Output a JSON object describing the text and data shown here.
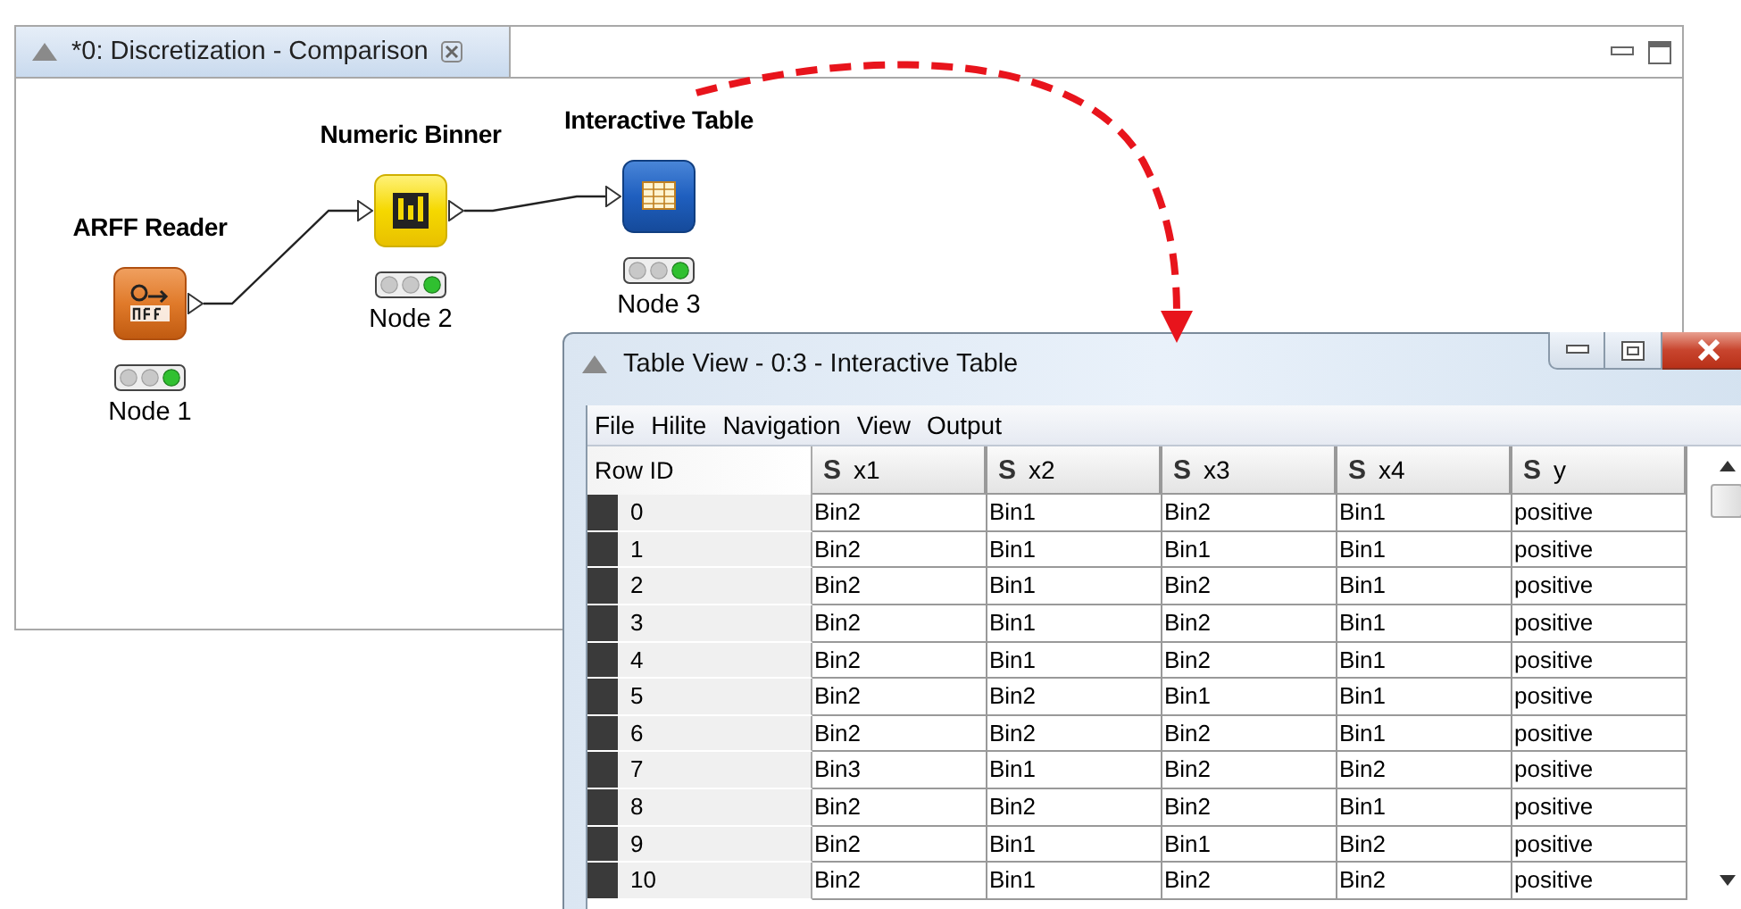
{
  "editor": {
    "tab_title": "*0: Discretization - Comparison",
    "nodes": [
      {
        "title": "ARFF Reader",
        "kind": "reader",
        "executed": true,
        "label": "Node 1"
      },
      {
        "title": "Numeric Binner",
        "kind": "binner",
        "executed": true,
        "label": "Node 2"
      },
      {
        "title": "Interactive Table",
        "kind": "table",
        "executed": true,
        "label": "Node 3"
      }
    ]
  },
  "table_view": {
    "title": "Table View - 0:3 - Interactive Table",
    "menu": [
      "File",
      "Hilite",
      "Navigation",
      "View",
      "Output"
    ],
    "row_id_header": "Row ID",
    "columns": [
      {
        "type_icon": "S",
        "label": "x1"
      },
      {
        "type_icon": "S",
        "label": "x2"
      },
      {
        "type_icon": "S",
        "label": "x3"
      },
      {
        "type_icon": "S",
        "label": "x4"
      },
      {
        "type_icon": "S",
        "label": "y"
      }
    ],
    "rows": [
      {
        "id": "0",
        "cells": [
          "Bin2",
          "Bin1",
          "Bin2",
          "Bin1",
          "positive"
        ]
      },
      {
        "id": "1",
        "cells": [
          "Bin2",
          "Bin1",
          "Bin1",
          "Bin1",
          "positive"
        ]
      },
      {
        "id": "2",
        "cells": [
          "Bin2",
          "Bin1",
          "Bin2",
          "Bin1",
          "positive"
        ]
      },
      {
        "id": "3",
        "cells": [
          "Bin2",
          "Bin1",
          "Bin2",
          "Bin1",
          "positive"
        ]
      },
      {
        "id": "4",
        "cells": [
          "Bin2",
          "Bin1",
          "Bin2",
          "Bin1",
          "positive"
        ]
      },
      {
        "id": "5",
        "cells": [
          "Bin2",
          "Bin2",
          "Bin1",
          "Bin1",
          "positive"
        ]
      },
      {
        "id": "6",
        "cells": [
          "Bin2",
          "Bin2",
          "Bin2",
          "Bin1",
          "positive"
        ]
      },
      {
        "id": "7",
        "cells": [
          "Bin3",
          "Bin1",
          "Bin2",
          "Bin2",
          "positive"
        ]
      },
      {
        "id": "8",
        "cells": [
          "Bin2",
          "Bin2",
          "Bin2",
          "Bin1",
          "positive"
        ]
      },
      {
        "id": "9",
        "cells": [
          "Bin2",
          "Bin1",
          "Bin1",
          "Bin2",
          "positive"
        ]
      },
      {
        "id": "10",
        "cells": [
          "Bin2",
          "Bin1",
          "Bin2",
          "Bin2",
          "positive"
        ]
      }
    ]
  }
}
